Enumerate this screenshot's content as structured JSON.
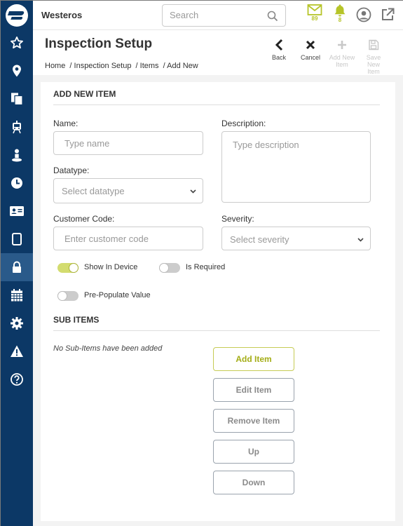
{
  "topbar": {
    "org_name": "Westeros",
    "search_placeholder": "Search",
    "mail_count": "89",
    "notification_count": "8"
  },
  "header": {
    "title": "Inspection Setup",
    "breadcrumb": [
      "Home",
      "/ Inspection Setup",
      "/ Items",
      "/ Add New"
    ],
    "actions": {
      "back": "Back",
      "cancel": "Cancel",
      "add_new_item": [
        "Add New",
        "Item"
      ],
      "save_new_item": [
        "Save New",
        "Item"
      ]
    }
  },
  "form": {
    "section_title": "ADD NEW ITEM",
    "name": {
      "label": "Name:",
      "placeholder": "Type name",
      "value": ""
    },
    "description": {
      "label": "Description:",
      "placeholder": "Type description",
      "value": ""
    },
    "datatype": {
      "label": "Datatype:",
      "placeholder": "Select datatype"
    },
    "customer_code": {
      "label": "Customer Code:",
      "placeholder": "Enter customer code",
      "value": ""
    },
    "severity": {
      "label": "Severity:",
      "placeholder": "Select severity"
    },
    "toggles": {
      "show_in_device": {
        "label": "Show In Device",
        "on": true
      },
      "is_required": {
        "label": "Is Required",
        "on": false
      },
      "pre_populate": {
        "label": "Pre-Populate Value",
        "on": false
      }
    }
  },
  "sub_items": {
    "section_title": "SUB ITEMS",
    "empty_text": "No Sub-Items have been added",
    "buttons": {
      "add": "Add Item",
      "edit": "Edit Item",
      "remove": "Remove Item",
      "up": "Up",
      "down": "Down"
    }
  },
  "sidebar": {
    "items": [
      "star-icon",
      "location-pin-icon",
      "documents-icon",
      "vehicle-icon",
      "person-icon",
      "clock-icon",
      "id-card-icon",
      "tablet-icon",
      "lock-icon",
      "calendar-icon",
      "gear-icon",
      "warning-icon",
      "help-icon"
    ],
    "active": "lock-icon"
  },
  "colors": {
    "sidebar": "#0c3866",
    "sidebar_active": "#2a5a8a",
    "accent": "#b6c428",
    "background": "#f3f3f3"
  }
}
